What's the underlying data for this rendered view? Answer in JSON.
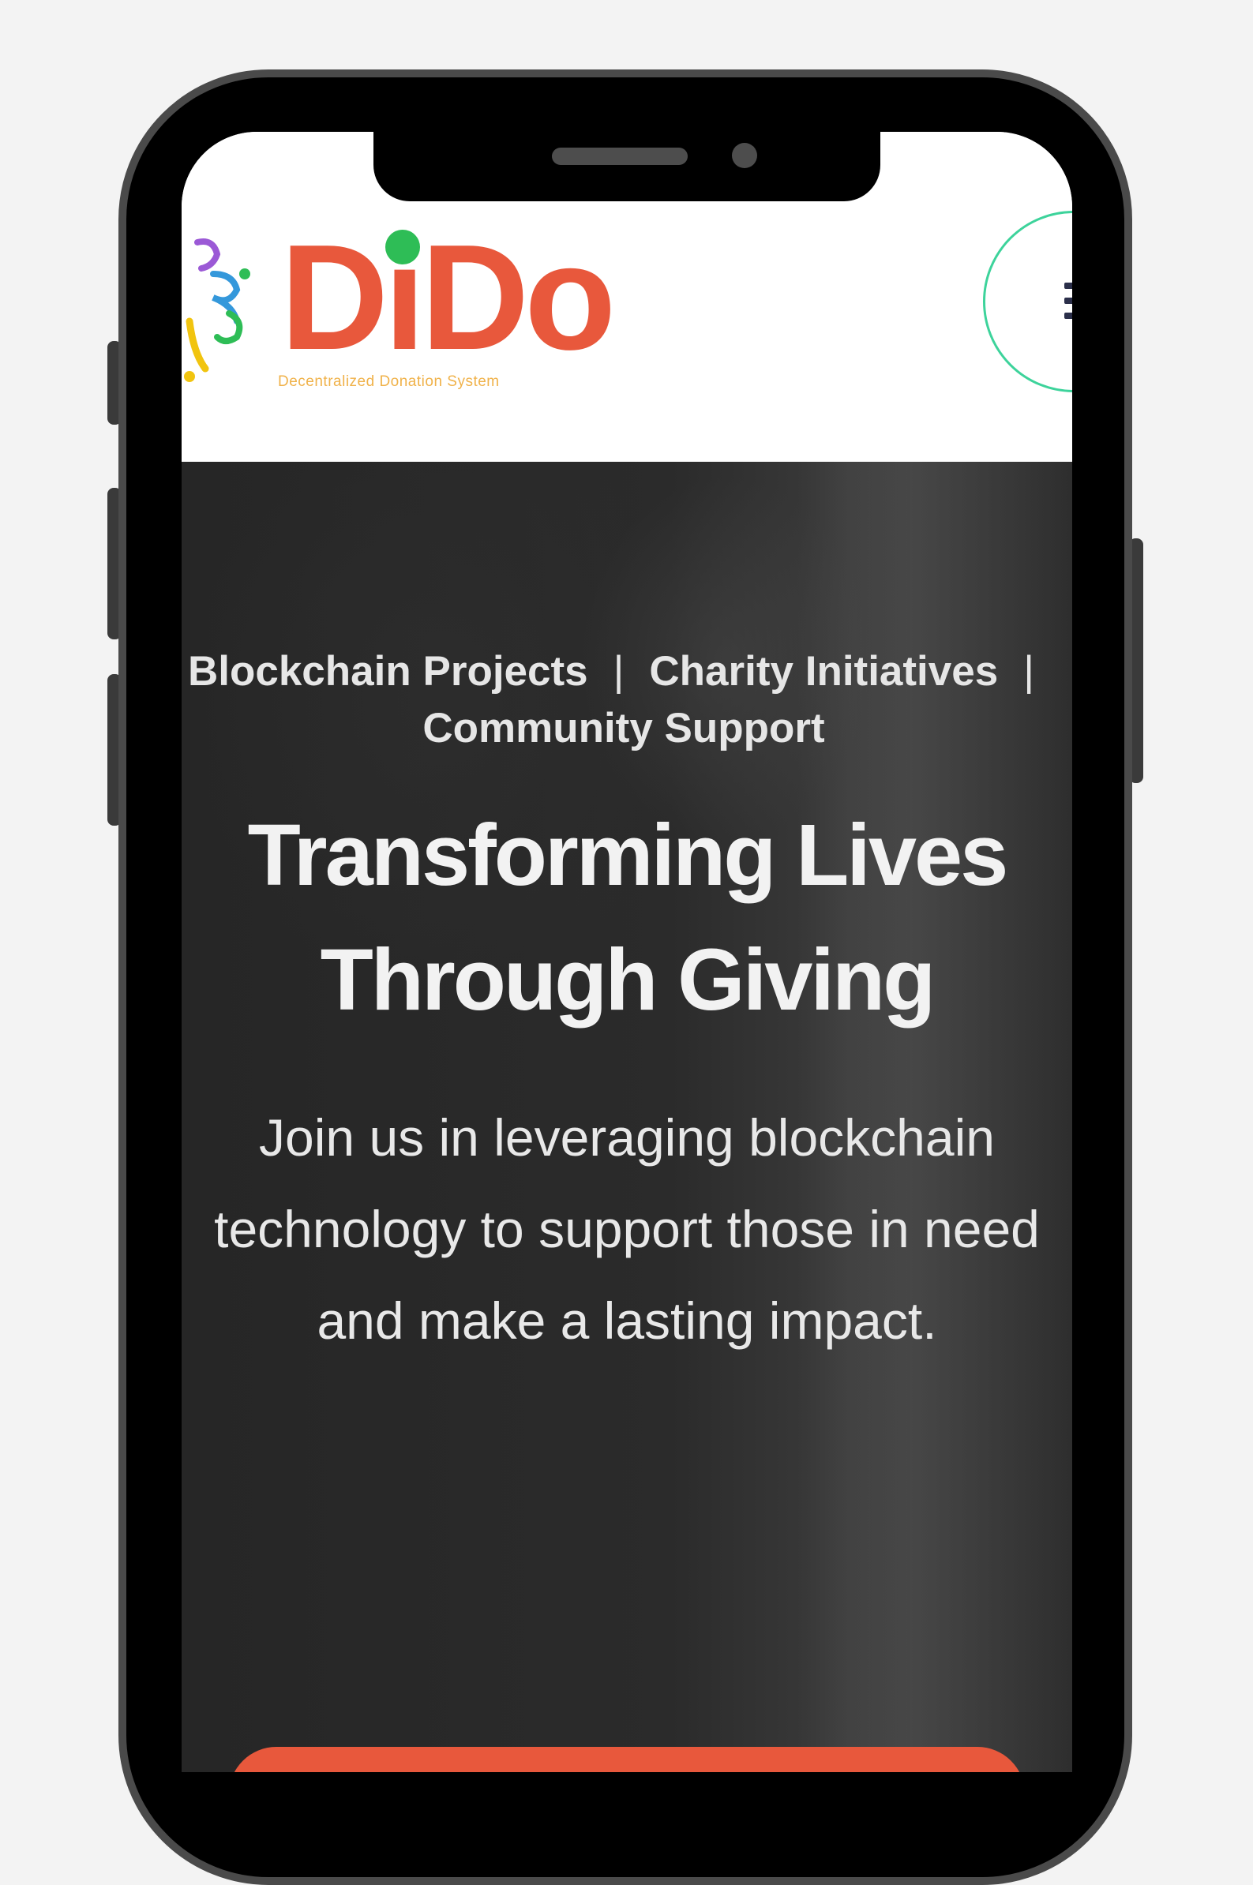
{
  "brand": {
    "name_part1": "D",
    "name_i": "i",
    "name_part2": "Do",
    "tagline": "Decentralized Donation System",
    "accent_color": "#e8583c",
    "dot_color": "#2ebd56",
    "tagline_color": "#f0b24a"
  },
  "header": {
    "menu_icon": "hamburger-icon"
  },
  "hero": {
    "categories": [
      "Blockchain Projects",
      "Charity Initiatives",
      "Community Support"
    ],
    "separator": "|",
    "title_line1": "Transforming Lives",
    "title_line2": "Through Giving",
    "subtitle": "Join us in leveraging blockchain technology to support those in need and make a lasting impact."
  }
}
